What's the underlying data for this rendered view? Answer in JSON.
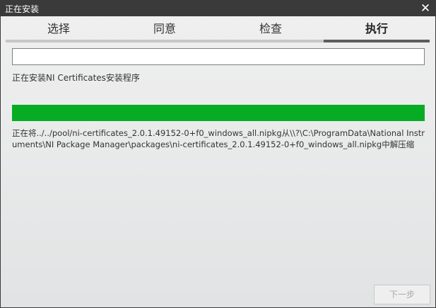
{
  "window": {
    "title": "正在安装",
    "close_icon": "close-icon"
  },
  "tabs": [
    {
      "label": "选择",
      "active": false
    },
    {
      "label": "同意",
      "active": false
    },
    {
      "label": "检查",
      "active": false
    },
    {
      "label": "执行",
      "active": true
    }
  ],
  "status_field": {
    "value": ""
  },
  "install_label": "正在安装NI Certificates安装程序",
  "progress": {
    "fraction": 1.0,
    "color": "#06ac24"
  },
  "detail_text": "正在将../../pool/ni-certificates_2.0.1.49152-0+f0_windows_all.nipkg从\\\\?\\C:\\ProgramData\\National Instruments\\NI Package Manager\\packages\\ni-certificates_2.0.1.49152-0+f0_windows_all.nipkg中解压缩",
  "buttons": {
    "next_label": "下一步",
    "next_enabled": false
  }
}
